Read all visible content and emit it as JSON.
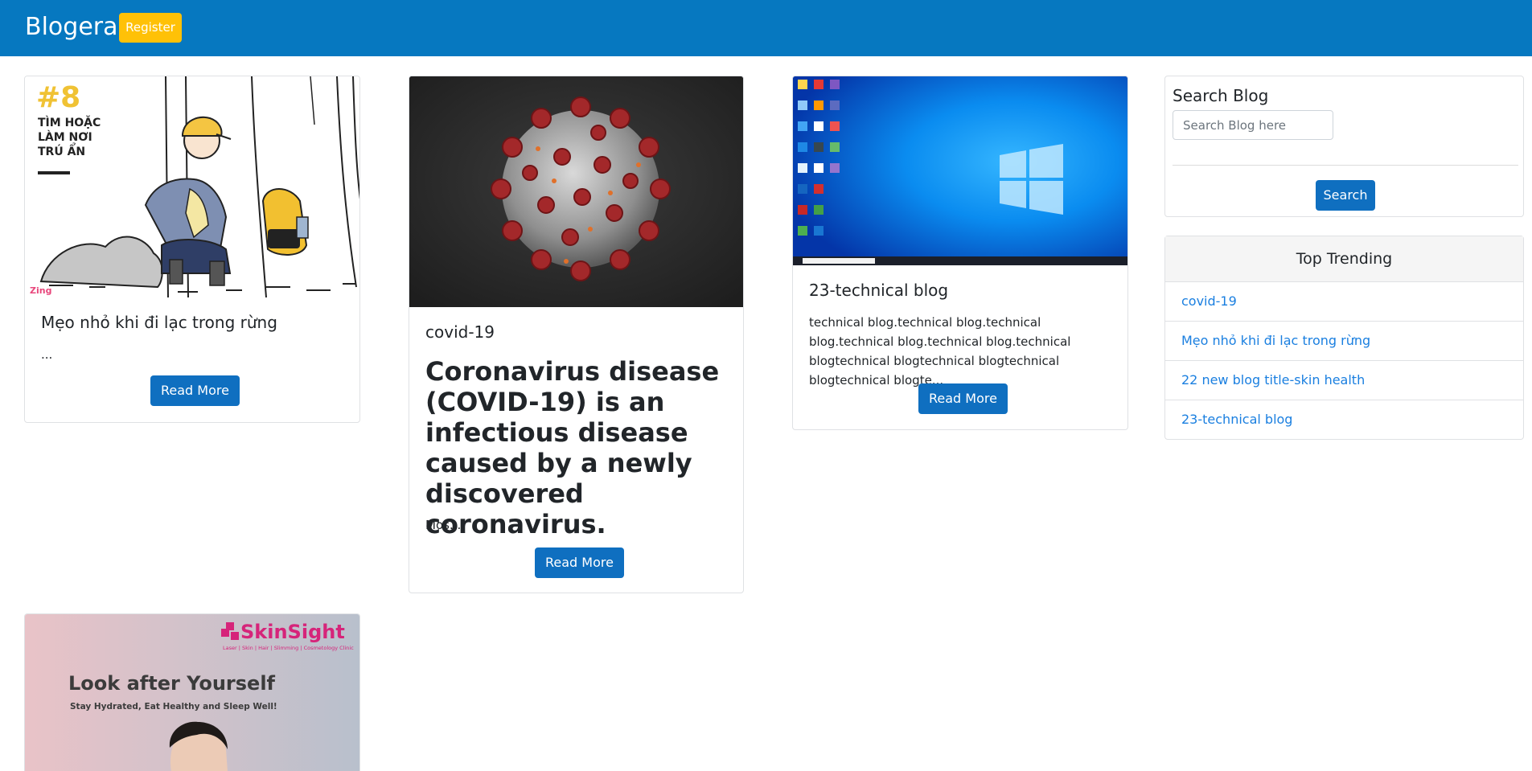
{
  "navbar": {
    "brand": "Blogera",
    "register_label": "Register"
  },
  "posts": [
    {
      "title": "Mẹo nhỏ khi đi lạc trong rừng",
      "excerpt": "...",
      "read_more": "Read More",
      "image": {
        "badge_number": "#8",
        "badge_lines": [
          "TÌM HOẶC",
          "LÀM NƠI",
          "TRÚ ẨN"
        ],
        "corner_text": "Zing"
      }
    },
    {
      "title": "covid-19",
      "headline": "Coronavirus disease (COVID-19) is an infectious disease caused by a newly discovered coronavirus.",
      "excerpt": "Mos...",
      "read_more": "Read More"
    },
    {
      "title": "23-technical blog",
      "excerpt": "technical blog.technical blog.technical blog.technical blog.technical blog.technical blogtechnical blogtechnical blogtechnical blogtechnical blogte...",
      "read_more": "Read More"
    },
    {
      "image": {
        "brand": "SkinSight",
        "brand_tagline": "Laser | Skin | Hair | Slimming | Cosmetology Clinic",
        "headline": "Look after Yourself",
        "subline": "Stay Hydrated, Eat Healthy and Sleep Well!"
      }
    }
  ],
  "sidebar": {
    "search": {
      "title": "Search Blog",
      "placeholder": "Search Blog here",
      "button_label": "Search"
    },
    "trending": {
      "title": "Top Trending",
      "items": [
        "covid-19",
        "Mẹo nhỏ khi đi lạc trong rừng",
        "22 new blog title-skin health",
        "23-technical blog"
      ]
    }
  },
  "colors": {
    "navbar": "#0678c0",
    "register": "#ffc107",
    "primary_button": "#0f6fc0",
    "link": "#1a7fe0"
  }
}
